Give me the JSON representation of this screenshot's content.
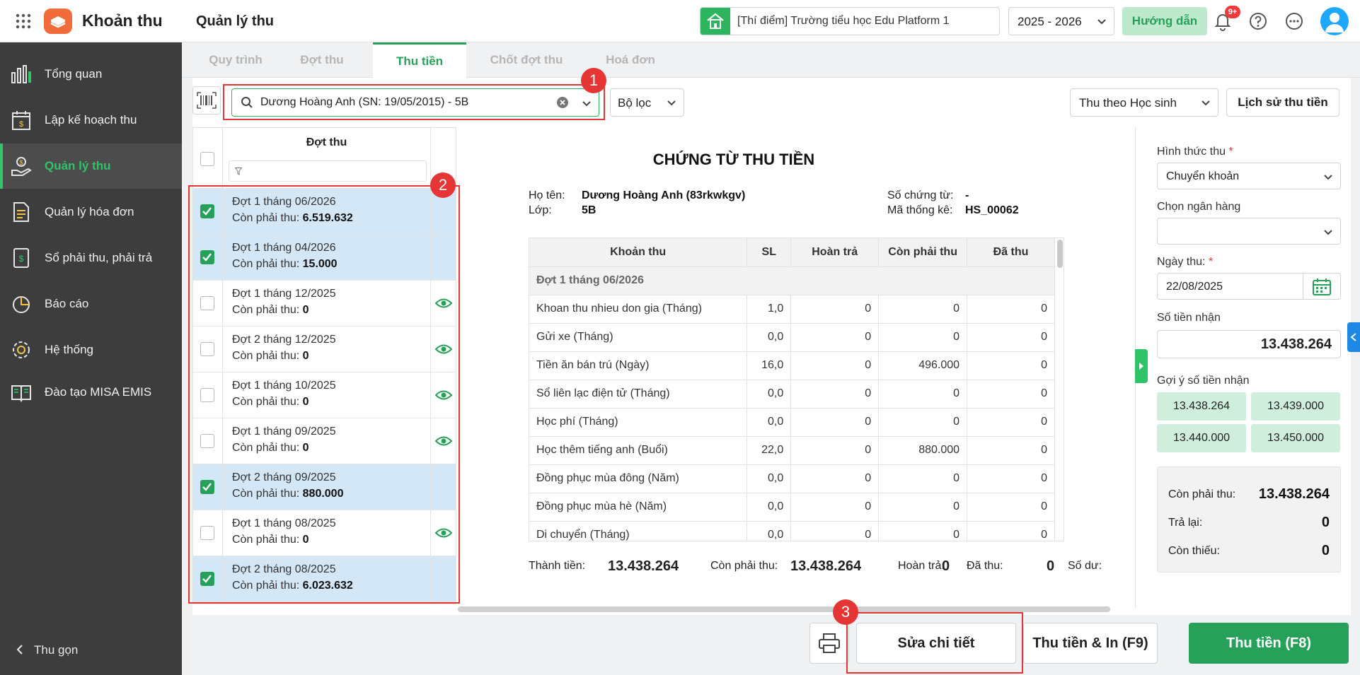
{
  "header": {
    "app_title": "Khoản thu",
    "page_title": "Quản lý thu",
    "school": "[Thí điểm] Trường tiểu học Edu Platform 1",
    "school_year": "2025 - 2026",
    "guide_label": "Hướng dẫn",
    "notification_badge": "9+"
  },
  "sidebar": {
    "items": [
      {
        "label": "Tổng quan",
        "icon": "chart-bars-icon"
      },
      {
        "label": "Lập kế hoạch thu",
        "icon": "calendar-money-icon"
      },
      {
        "label": "Quản lý thu",
        "icon": "hand-coin-icon"
      },
      {
        "label": "Quản lý hóa đơn",
        "icon": "invoice-icon"
      },
      {
        "label": "Sổ phải thu, phải trả",
        "icon": "ledger-icon"
      },
      {
        "label": "Báo cáo",
        "icon": "pie-chart-icon"
      },
      {
        "label": "Hệ thống",
        "icon": "gear-icon"
      },
      {
        "label": "Đào tạo MISA EMIS",
        "icon": "book-icon"
      }
    ],
    "collapse_label": "Thu gọn"
  },
  "tabs": [
    "Quy trình",
    "Đợt thu",
    "Thu tiền",
    "Chốt đợt thu",
    "Hoá đơn"
  ],
  "toolbar": {
    "search_value": "Dương Hoàng Anh (SN: 19/05/2015) - 5B",
    "filter_label": "Bộ lọc",
    "mode_label": "Thu theo Học sinh",
    "history_label": "Lịch sử thu tiền"
  },
  "callouts": [
    "1",
    "2",
    "3"
  ],
  "periods": {
    "header": "Đợt thu",
    "remain_label": "Còn phải thu:",
    "rows": [
      {
        "name": "Đợt 1 tháng 06/2026",
        "remain": "6.519.632",
        "checked": true
      },
      {
        "name": "Đợt 1 tháng 04/2026",
        "remain": "15.000",
        "checked": true
      },
      {
        "name": "Đợt 1 tháng 12/2025",
        "remain": "0",
        "checked": false
      },
      {
        "name": "Đợt 2 tháng 12/2025",
        "remain": "0",
        "checked": false
      },
      {
        "name": "Đợt 1 tháng 10/2025",
        "remain": "0",
        "checked": false
      },
      {
        "name": "Đợt 1 tháng 09/2025",
        "remain": "0",
        "checked": false
      },
      {
        "name": "Đợt 2 tháng 09/2025",
        "remain": "880.000",
        "checked": true
      },
      {
        "name": "Đợt 1 tháng 08/2025",
        "remain": "0",
        "checked": false
      },
      {
        "name": "Đợt 2 tháng 08/2025",
        "remain": "6.023.632",
        "checked": true
      }
    ]
  },
  "voucher": {
    "title": "CHỨNG TỪ THU TIỀN",
    "name_label": "Họ tên:",
    "name_value": "Dương Hoàng Anh (83rkwkgv)",
    "class_label": "Lớp:",
    "class_value": "5B",
    "doc_no_label": "Số chứng từ:",
    "doc_no_value": "-",
    "stat_code_label": "Mã thống kê:",
    "stat_code_value": "HS_00062",
    "columns": [
      "Khoản thu",
      "SL",
      "Hoàn trả",
      "Còn phải thu",
      "Đã thu"
    ],
    "group": "Đợt 1 tháng 06/2026",
    "rows": [
      [
        "Khoan thu nhieu don gia (Tháng)",
        "1,0",
        "0",
        "0",
        "0"
      ],
      [
        "Gửi xe (Tháng)",
        "0,0",
        "0",
        "0",
        "0"
      ],
      [
        "Tiền ăn bán trú (Ngày)",
        "16,0",
        "0",
        "496.000",
        "0"
      ],
      [
        "Sổ liên lạc điện tử (Tháng)",
        "0,0",
        "0",
        "0",
        "0"
      ],
      [
        "Học phí (Tháng)",
        "0,0",
        "0",
        "0",
        "0"
      ],
      [
        "Học thêm tiếng anh (Buổi)",
        "22,0",
        "0",
        "880.000",
        "0"
      ],
      [
        "Đồng phục mùa đông (Năm)",
        "0,0",
        "0",
        "0",
        "0"
      ],
      [
        "Đồng phục mùa hè (Năm)",
        "0,0",
        "0",
        "0",
        "0"
      ],
      [
        "Di chuyển (Tháng)",
        "0,0",
        "0",
        "0",
        "0"
      ]
    ],
    "totals": {
      "amount_label": "Thành tiền:",
      "amount": "13.438.264",
      "remain_label": "Còn phải thu:",
      "remain": "13.438.264",
      "refund_label": "Hoàn trả:",
      "refund": "0",
      "paid_label": "Đã thu:",
      "paid": "0",
      "balance_label": "Số dư:"
    }
  },
  "form": {
    "method_label": "Hình thức thu",
    "method_value": "Chuyển khoản",
    "bank_label": "Chọn ngân hàng",
    "bank_value": "",
    "date_label": "Ngày thu:",
    "date_value": "22/08/2025",
    "received_label": "Số tiền nhận",
    "received_value": "13.438.264",
    "suggest_label": "Gợi ý số tiền nhận",
    "suggestions": [
      "13.438.264",
      "13.439.000",
      "13.440.000",
      "13.450.000"
    ],
    "summary": {
      "remain_label": "Còn phải thu:",
      "remain": "13.438.264",
      "return_label": "Trả lại:",
      "return": "0",
      "short_label": "Còn thiếu:",
      "short": "0"
    }
  },
  "footer": {
    "edit_label": "Sửa chi tiết",
    "collect_print_label": "Thu tiền & In (F9)",
    "collect_label": "Thu tiền (F8)"
  },
  "colors": {
    "accent": "#27a15a",
    "sidebar": "#3d3d3d",
    "callout": "#e53535",
    "selected_row": "#d3e7f7"
  }
}
